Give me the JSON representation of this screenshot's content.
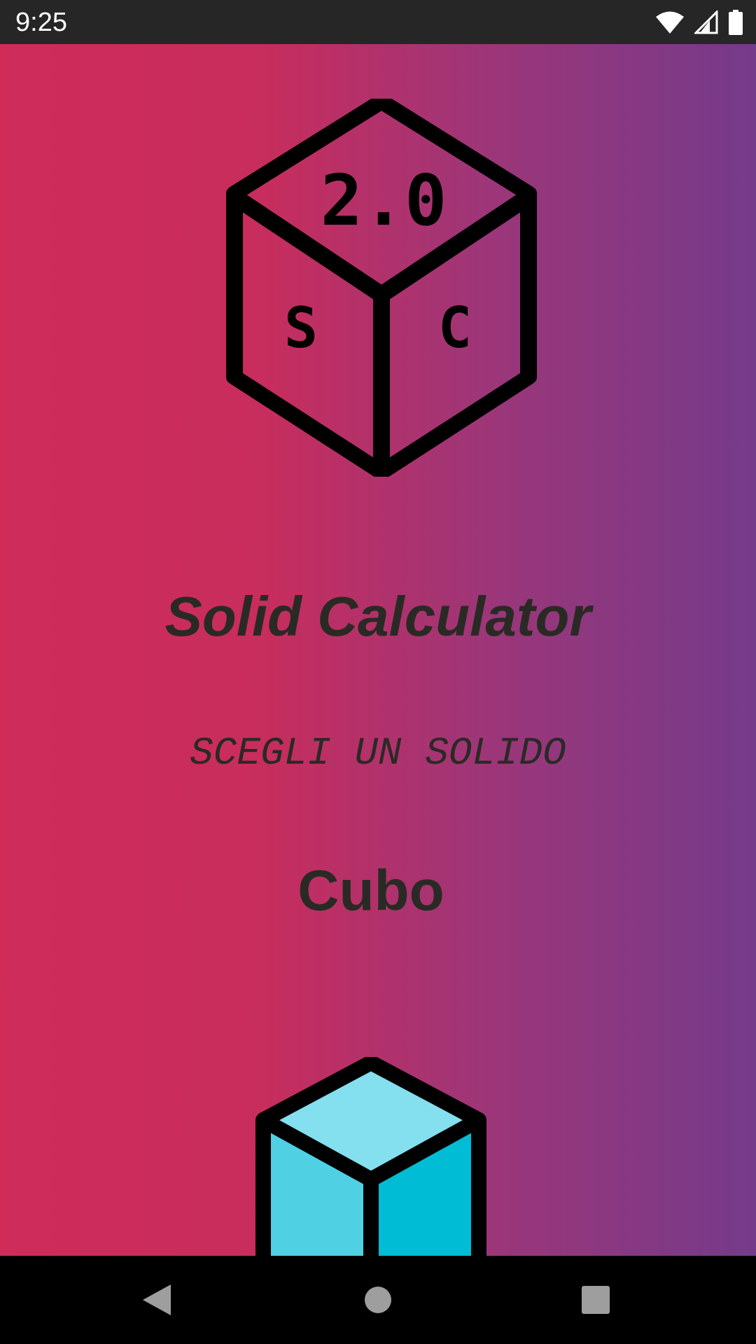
{
  "status_bar": {
    "time": "9:25",
    "icons": [
      "wifi-icon",
      "cellular-signal-icon",
      "battery-icon"
    ]
  },
  "main": {
    "logo": {
      "top_label": "2.0",
      "left_label": "S",
      "right_label": "C"
    },
    "app_title": "Solid Calculator",
    "subtitle": "SCEGLI UN SOLIDO",
    "solid_name": "Cubo",
    "solid_icon": "cube-icon"
  },
  "nav_bar": {
    "buttons": [
      "back-icon",
      "home-icon",
      "recents-icon"
    ]
  },
  "colors": {
    "gradient_start": "#cf2c5a",
    "gradient_end": "#743b8a",
    "text": "#2a2a25",
    "cube_top": "#84dfee",
    "cube_left": "#4fd1e3",
    "cube_right": "#00bcd4"
  }
}
